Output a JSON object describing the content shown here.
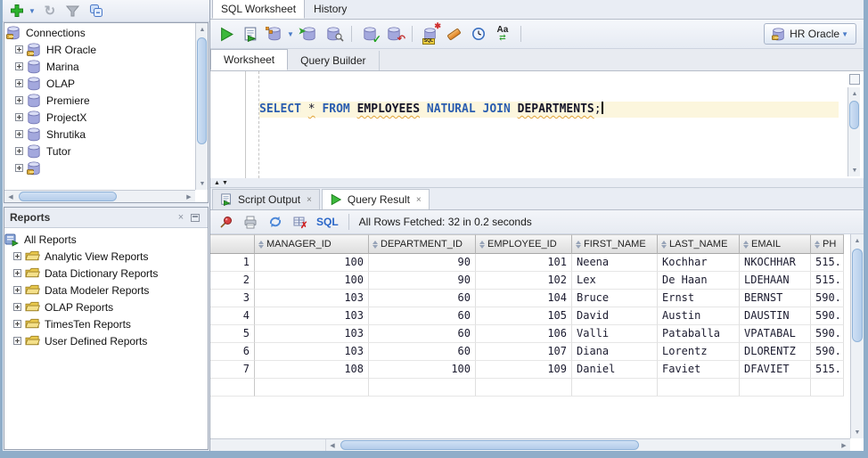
{
  "colors": {
    "frame": "#8fadc9",
    "panelbg": "#e9edf4",
    "curline": "#fcf6dd",
    "kwblue": "#2a5db0",
    "sqllink": "#2a66c8"
  },
  "left": {
    "toolbar_icons": [
      "add-connection-icon",
      "dropdown-arrow-icon",
      "refresh-icon",
      "filter-icon",
      "collapse-all-icon"
    ],
    "connections": {
      "root": "Connections",
      "items": [
        "HR Oracle",
        "Marina",
        "OLAP",
        "Premiere",
        "ProjectX",
        "Shrutika",
        "Tutor"
      ]
    },
    "reports": {
      "title": "Reports",
      "close_glyph": "×",
      "root": "All Reports",
      "items": [
        "Analytic View Reports",
        "Data Dictionary Reports",
        "Data Modeler Reports",
        "OLAP Reports",
        "TimesTen Reports",
        "User Defined Reports"
      ]
    }
  },
  "main": {
    "doc_tabs": [
      "SQL Worksheet",
      "History"
    ],
    "toolbar": {
      "icons": [
        "run-statement-icon",
        "run-script-icon",
        "autotrace-icon",
        "autotrace-dropdown-icon",
        "explain-plan-icon",
        "sql-tuning-advisor-icon",
        "commit-icon",
        "rollback-icon",
        "unshared-worksheet-icon",
        "clear-icon",
        "sql-history-icon",
        "change-case-icon"
      ],
      "connection": "HR Oracle"
    },
    "editor_tabs": [
      "Worksheet",
      "Query Builder"
    ],
    "sql": {
      "tokens": [
        {
          "text": "SELECT",
          "cls": "kw"
        },
        {
          "text": " ",
          "cls": "pl"
        },
        {
          "text": "*",
          "cls": "pl warn"
        },
        {
          "text": " ",
          "cls": "pl"
        },
        {
          "text": "FROM",
          "cls": "kw"
        },
        {
          "text": " ",
          "cls": "pl"
        },
        {
          "text": "EMPLOYEES",
          "cls": "id warn"
        },
        {
          "text": " ",
          "cls": "pl"
        },
        {
          "text": "NATURAL",
          "cls": "kw"
        },
        {
          "text": " ",
          "cls": "pl"
        },
        {
          "text": "JOIN",
          "cls": "kw"
        },
        {
          "text": " ",
          "cls": "pl"
        },
        {
          "text": "DEPARTMENTS",
          "cls": "id warn"
        },
        {
          "text": ";",
          "cls": "pl"
        }
      ]
    },
    "result_tabs": [
      {
        "label": "Script Output",
        "close": "×"
      },
      {
        "label": "Query Result",
        "close": "×"
      }
    ],
    "result_toolbar": {
      "icons": [
        "pin-icon",
        "print-icon",
        "refresh-icon",
        "clear-grid-icon"
      ],
      "sql_label": "SQL",
      "status": "All Rows Fetched: 32 in 0.2 seconds"
    },
    "grid": {
      "columns": [
        {
          "label": "MANAGER_ID",
          "align": "num"
        },
        {
          "label": "DEPARTMENT_ID",
          "align": "num"
        },
        {
          "label": "EMPLOYEE_ID",
          "align": "num"
        },
        {
          "label": "FIRST_NAME",
          "align": "txt"
        },
        {
          "label": "LAST_NAME",
          "align": "txt"
        },
        {
          "label": "EMAIL",
          "align": "txt"
        },
        {
          "label": "PH",
          "align": "txt"
        }
      ],
      "rows": [
        [
          "1",
          "100",
          "90",
          "101",
          "Neena",
          "Kochhar",
          "NKOCHHAR",
          "515."
        ],
        [
          "2",
          "100",
          "90",
          "102",
          "Lex",
          "De Haan",
          "LDEHAAN",
          "515."
        ],
        [
          "3",
          "103",
          "60",
          "104",
          "Bruce",
          "Ernst",
          "BERNST",
          "590."
        ],
        [
          "4",
          "103",
          "60",
          "105",
          "David",
          "Austin",
          "DAUSTIN",
          "590."
        ],
        [
          "5",
          "103",
          "60",
          "106",
          "Valli",
          "Pataballa",
          "VPATABAL",
          "590."
        ],
        [
          "6",
          "103",
          "60",
          "107",
          "Diana",
          "Lorentz",
          "DLORENTZ",
          "590."
        ],
        [
          "7",
          "108",
          "100",
          "109",
          "Daniel",
          "Faviet",
          "DFAVIET",
          "515."
        ]
      ]
    }
  }
}
